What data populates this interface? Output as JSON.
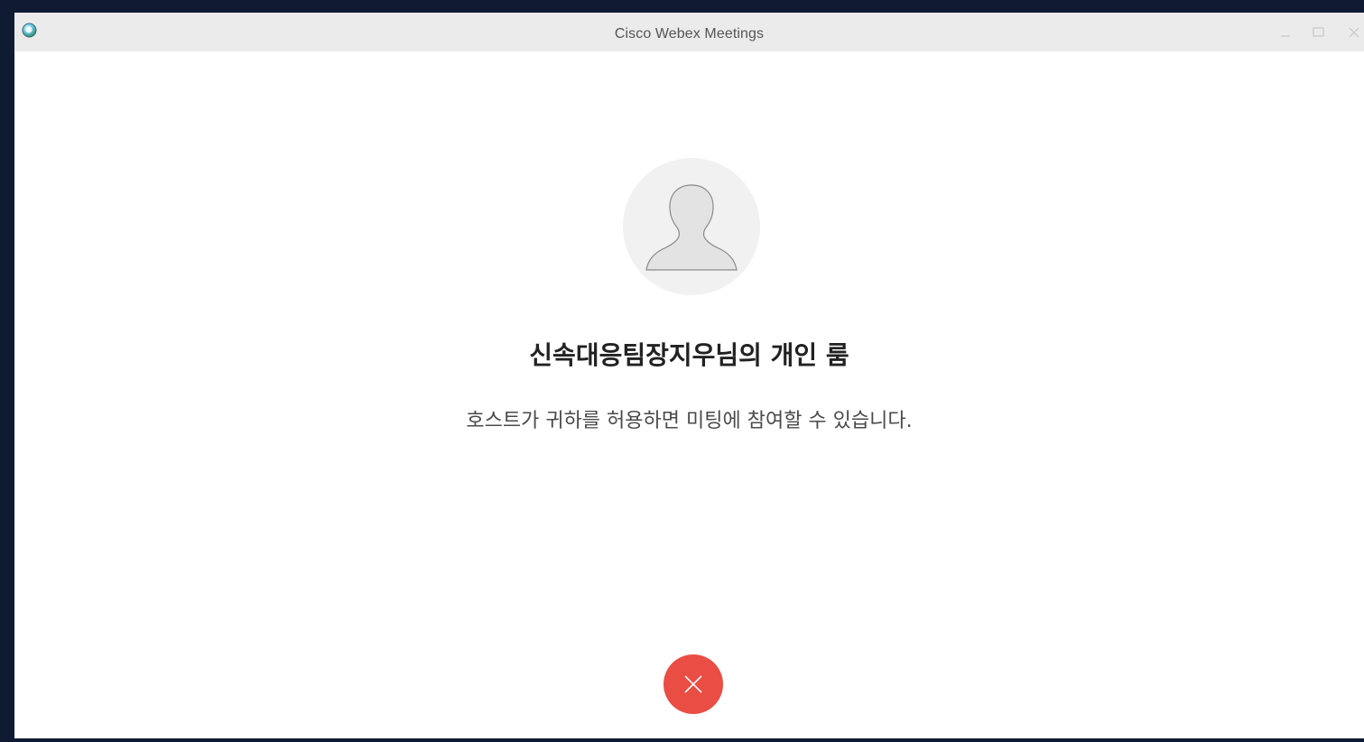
{
  "window": {
    "title": "Cisco Webex Meetings",
    "controls": {
      "minimize_icon": "minimize-icon",
      "maximize_icon": "maximize-icon",
      "close_icon": "close-icon"
    }
  },
  "lobby": {
    "avatar_icon": "person-silhouette-icon",
    "room_name": "신속대응팀장지우님의 개인 룸",
    "message": "호스트가 귀하를 허용하면 미팅에 참여할 수 있습니다.",
    "leave_button": {
      "icon": "close-icon",
      "color": "#ea4d43"
    }
  },
  "colors": {
    "titlebar": "#ebebeb",
    "background": "#ffffff",
    "leave_red": "#ea4d43"
  }
}
